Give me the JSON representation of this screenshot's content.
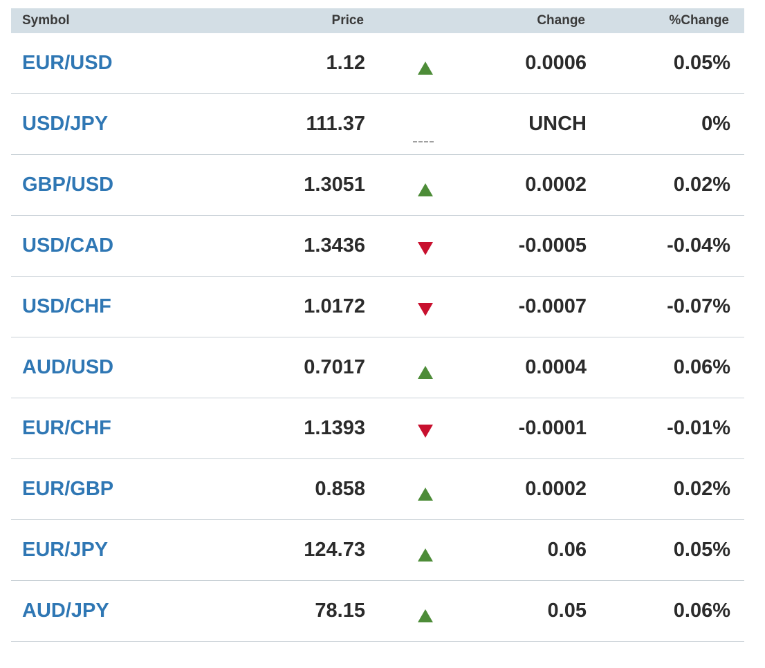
{
  "header": {
    "symbol": "Symbol",
    "price": "Price",
    "change": "Change",
    "pct_change": "%Change"
  },
  "rows": [
    {
      "symbol": "EUR/USD",
      "price": "1.12",
      "direction": "up",
      "change": "0.0006",
      "pct_change": "0.05%"
    },
    {
      "symbol": "USD/JPY",
      "price": "111.37",
      "direction": "flat",
      "change": "UNCH",
      "pct_change": "0%"
    },
    {
      "symbol": "GBP/USD",
      "price": "1.3051",
      "direction": "up",
      "change": "0.0002",
      "pct_change": "0.02%"
    },
    {
      "symbol": "USD/CAD",
      "price": "1.3436",
      "direction": "down",
      "change": "-0.0005",
      "pct_change": "-0.04%"
    },
    {
      "symbol": "USD/CHF",
      "price": "1.0172",
      "direction": "down",
      "change": "-0.0007",
      "pct_change": "-0.07%"
    },
    {
      "symbol": "AUD/USD",
      "price": "0.7017",
      "direction": "up",
      "change": "0.0004",
      "pct_change": "0.06%"
    },
    {
      "symbol": "EUR/CHF",
      "price": "1.1393",
      "direction": "down",
      "change": "-0.0001",
      "pct_change": "-0.01%"
    },
    {
      "symbol": "EUR/GBP",
      "price": "0.858",
      "direction": "up",
      "change": "0.0002",
      "pct_change": "0.02%"
    },
    {
      "symbol": "EUR/JPY",
      "price": "124.73",
      "direction": "up",
      "change": "0.06",
      "pct_change": "0.05%"
    },
    {
      "symbol": "AUD/JPY",
      "price": "78.15",
      "direction": "up",
      "change": "0.05",
      "pct_change": "0.06%"
    }
  ],
  "colors": {
    "symbol_link": "#2f77b4",
    "up": "#4d8c38",
    "down": "#c8102e",
    "unchanged": "#a0a0a0",
    "header_bg": "#d3dee5"
  },
  "icons": {
    "up": "triangle-up-icon",
    "down": "triangle-down-icon",
    "flat": "dashes-icon"
  }
}
